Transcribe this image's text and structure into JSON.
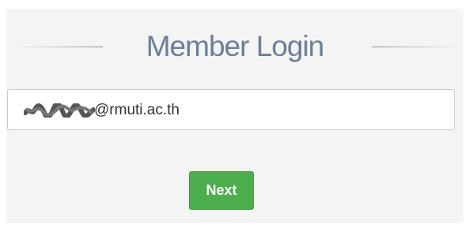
{
  "header": {
    "title": "Member Login"
  },
  "login_form": {
    "email_value_visible": "@rmuti.ac.th",
    "email_value_redacted": true,
    "next_label": "Next"
  },
  "colors": {
    "title_text": "#6b7f99",
    "panel_bg": "#f4f4f4",
    "button_bg": "#4cae4c",
    "button_text": "#ffffff"
  }
}
